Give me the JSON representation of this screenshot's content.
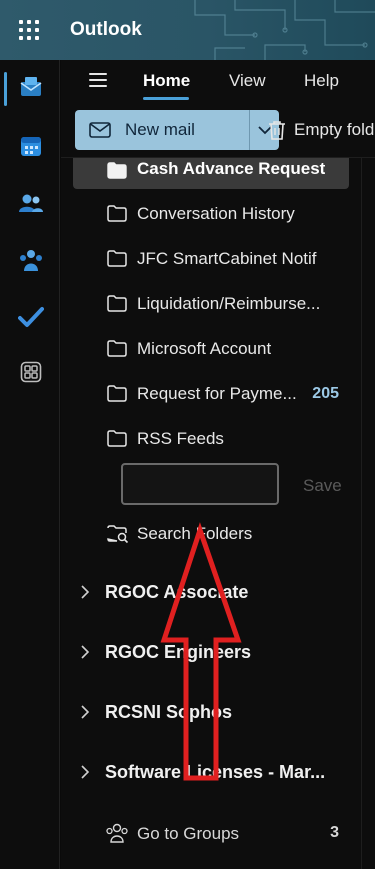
{
  "app": {
    "title": "Outlook"
  },
  "ribbon": {
    "tabs": [
      {
        "label": "Home",
        "active": true
      },
      {
        "label": "View",
        "active": false
      },
      {
        "label": "Help",
        "active": false
      }
    ]
  },
  "commands": {
    "new_mail": "New mail",
    "empty_folder": "Empty fold"
  },
  "folders": [
    {
      "label": "Cash Advance Request",
      "selected": true,
      "count": ""
    },
    {
      "label": "Conversation History",
      "selected": false,
      "count": ""
    },
    {
      "label": "JFC SmartCabinet Notif",
      "selected": false,
      "count": ""
    },
    {
      "label": "Liquidation/Reimburse...",
      "selected": false,
      "count": ""
    },
    {
      "label": "Microsoft Account",
      "selected": false,
      "count": ""
    },
    {
      "label": "Request for Payme...",
      "selected": false,
      "count": "205"
    },
    {
      "label": "RSS Feeds",
      "selected": false,
      "count": ""
    }
  ],
  "new_folder": {
    "value": "",
    "save_label": "Save"
  },
  "search_folders": {
    "label": "Search Folders"
  },
  "groups": [
    {
      "label": "RGOC Associate"
    },
    {
      "label": "RGOC Engineers"
    },
    {
      "label": "RCSNI Sophos"
    },
    {
      "label": "Software Licenses - Mar..."
    }
  ],
  "go_to_groups": {
    "label": "Go to Groups",
    "count": "3"
  },
  "colors": {
    "accent": "#4aa0d8",
    "new_mail_bg": "#9ac4dc",
    "annotation": "#e02020"
  }
}
